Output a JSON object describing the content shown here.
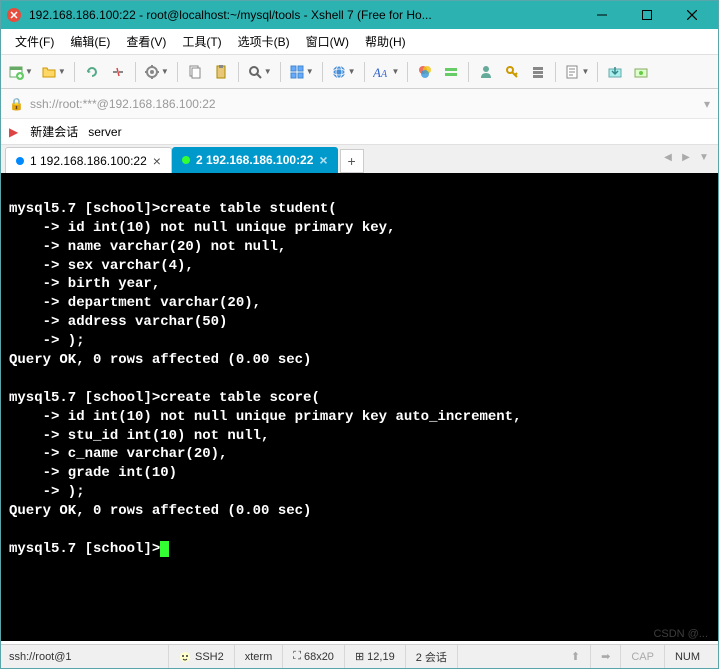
{
  "window": {
    "title": "192.168.186.100:22 - root@localhost:~/mysql/tools - Xshell 7 (Free for Ho..."
  },
  "menu": {
    "file": "文件(F)",
    "edit": "编辑(E)",
    "view": "查看(V)",
    "tools": "工具(T)",
    "tabs": "选项卡(B)",
    "window": "窗口(W)",
    "help": "帮助(H)"
  },
  "addressbar": {
    "url": "ssh://root:***@192.168.186.100:22"
  },
  "sessionbar": {
    "newsession": "新建会话",
    "server": "server"
  },
  "tabs": {
    "inactive_label": "1 192.168.186.100:22",
    "active_label": "2 192.168.186.100:22"
  },
  "terminal": {
    "lines": [
      "",
      "mysql5.7 [school]>create table student(",
      "    -> id int(10) not null unique primary key,",
      "    -> name varchar(20) not null,",
      "    -> sex varchar(4),",
      "    -> birth year,",
      "    -> department varchar(20),",
      "    -> address varchar(50)",
      "    -> );",
      "Query OK, 0 rows affected (0.00 sec)",
      "",
      "mysql5.7 [school]>create table score(",
      "    -> id int(10) not null unique primary key auto_increment,",
      "    -> stu_id int(10) not null,",
      "    -> c_name varchar(20),",
      "    -> grade int(10)",
      "    -> );",
      "Query OK, 0 rows affected (0.00 sec)",
      ""
    ],
    "prompt": "mysql5.7 [school]>"
  },
  "statusbar": {
    "path": "ssh://root@1",
    "protocol": "SSH2",
    "termtype": "xterm",
    "size": "68x20",
    "cursor": "12,19",
    "sessions": "2 会话",
    "caps": "CAP",
    "num": "NUM"
  },
  "watermark": "CSDN @..."
}
